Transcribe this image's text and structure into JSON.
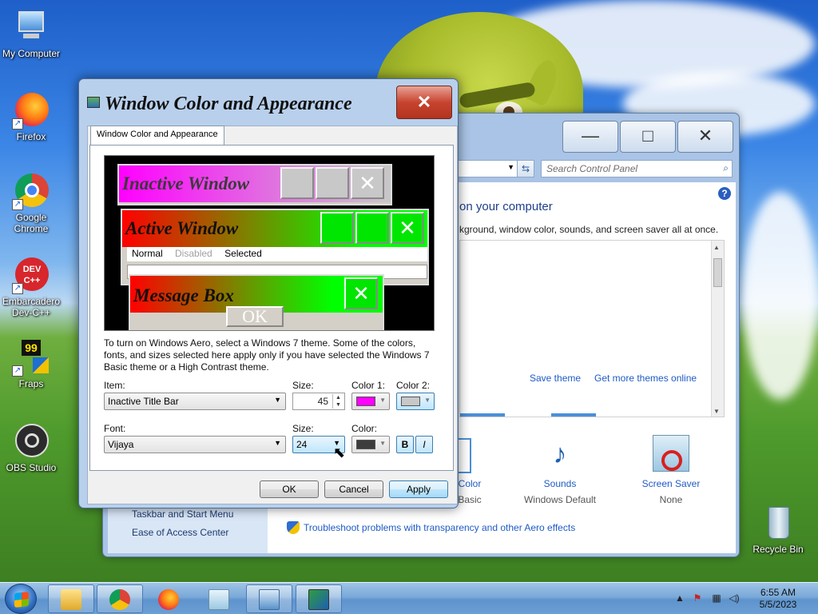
{
  "desktop": {
    "icons": [
      {
        "label": "My Computer"
      },
      {
        "label": "Firefox"
      },
      {
        "label": "Google Chrome"
      },
      {
        "label": "Embarcadero Dev-C++"
      },
      {
        "label": "Fraps"
      },
      {
        "label": "OBS Studio"
      },
      {
        "label": "Recycle Bin"
      }
    ],
    "devcpp_badge": "DEV C++",
    "fraps_badge": "99"
  },
  "control_panel": {
    "minimize": "—",
    "maximize": "□",
    "close": "✕",
    "search_placeholder": "Search Control Panel",
    "heading": "on your computer",
    "subheading": "kground, window color, sounds, and screen saver all at once.",
    "save_theme": "Save theme",
    "more_themes": "Get more themes online",
    "items": [
      {
        "caption": "Color",
        "value": "Basic"
      },
      {
        "caption": "Sounds",
        "value": "Windows Default"
      },
      {
        "caption": "Screen Saver",
        "value": "None"
      }
    ],
    "left_links": [
      "Taskbar and Start Menu",
      "Ease of Access Center"
    ],
    "troubleshoot": "Troubleshoot problems with transparency and other Aero effects",
    "help": "?"
  },
  "dialog": {
    "title": "Window Color and Appearance",
    "close": "✕",
    "tab": "Window Color and Appearance",
    "preview": {
      "inactive_title": "Inactive Window",
      "active_title": "Active Window",
      "menu": [
        "Normal",
        "Disabled",
        "Selected"
      ],
      "message_title": "Message Box",
      "ok": "OK"
    },
    "description": "To turn on Windows Aero, select a Windows 7 theme.  Some of the colors, fonts, and sizes selected here apply only if you have selected the Windows 7 Basic theme or a High Contrast theme.",
    "item_label": "Item:",
    "item_value": "Inactive Title Bar",
    "size_label": "Size:",
    "size_value": "45",
    "color1_label": "Color 1:",
    "color2_label": "Color 2:",
    "color1": "#ff00ff",
    "color2": "#c8c8c8",
    "font_label": "Font:",
    "font_value": "Vijaya",
    "font_size_label": "Size:",
    "font_size_value": "24",
    "font_color_label": "Color:",
    "font_color": "#3c3c3c",
    "bold": "B",
    "italic": "I",
    "ok": "OK",
    "cancel": "Cancel",
    "apply": "Apply"
  },
  "taskbar": {
    "time": "6:55 AM",
    "date": "5/5/2023"
  }
}
